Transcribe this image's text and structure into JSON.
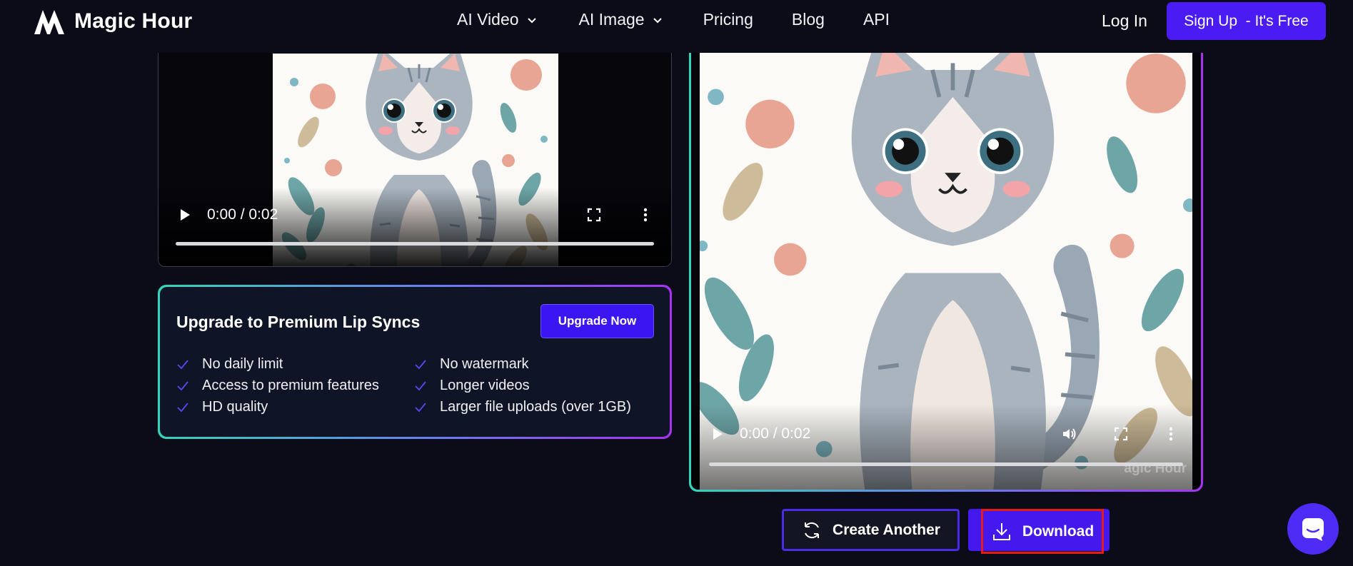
{
  "nav": {
    "logo_text": "Magic Hour",
    "links": [
      {
        "label": "AI Video"
      },
      {
        "label": "AI Image"
      },
      {
        "label": "Pricing"
      },
      {
        "label": "Blog"
      },
      {
        "label": "API"
      }
    ],
    "login": "Log In",
    "signup": "Sign Up  - It's Free"
  },
  "source_video": {
    "time": "0:00 / 0:02",
    "progress": 0
  },
  "upgrade": {
    "title": "Upgrade to Premium Lip Syncs",
    "button": "Upgrade Now",
    "features": [
      "No daily limit",
      "No watermark",
      "Access to premium features",
      "Longer videos",
      "HD quality",
      "Larger file uploads (over 1GB)"
    ]
  },
  "result_video": {
    "time": "0:00 / 0:02",
    "progress": 0,
    "watermark": "agic Hour"
  },
  "actions": {
    "create_another": "Create Another",
    "download": "Download"
  },
  "colors": {
    "accent": "#4a1bf2",
    "background": "#0b0c17",
    "card": "#0f1526",
    "gradient_start": "#34d5b9",
    "gradient_end": "#a533f0",
    "highlight": "#e81919"
  },
  "icons": [
    "magic-hour-logo-icon",
    "chevron-down-icon",
    "play-icon",
    "volume-icon",
    "fullscreen-icon",
    "more-vertical-icon",
    "check-icon",
    "refresh-icon",
    "download-icon",
    "chat-icon"
  ]
}
